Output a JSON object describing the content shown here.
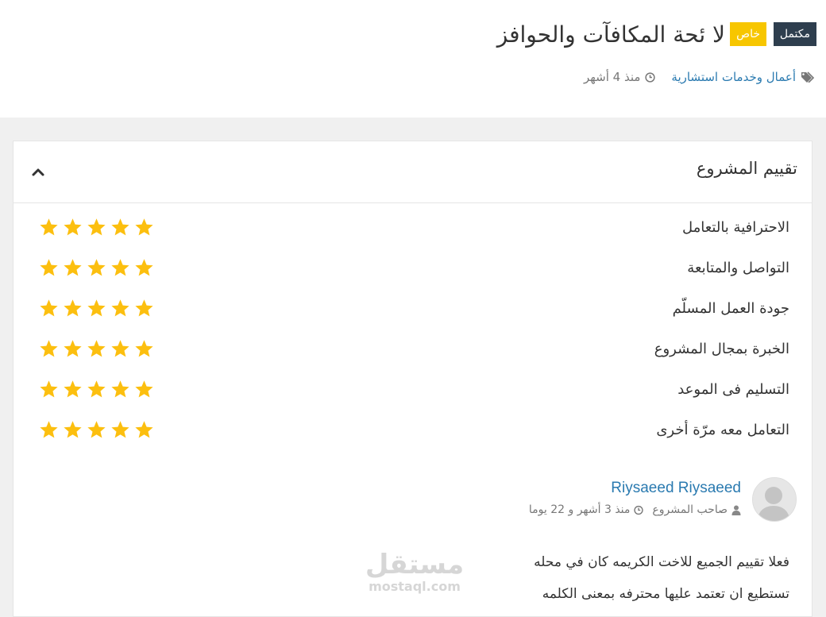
{
  "project": {
    "status_badge": "مكتمل",
    "privacy_badge": "خاص",
    "title": "لا ئحة المكافآت والحوافز",
    "category": "أعمال وخدمات استشارية",
    "posted": "منذ 4 أشهر"
  },
  "colors": {
    "accent_blue": "#2a7ab0",
    "badge_dark": "#2e3e4e",
    "badge_yellow": "#f7c600",
    "star": "#fcbf0f"
  },
  "rating": {
    "title": "تقييم المشروع",
    "criteria": [
      {
        "label": "الاحترافية بالتعامل",
        "stars": 5
      },
      {
        "label": "التواصل والمتابعة",
        "stars": 5
      },
      {
        "label": "جودة العمل المسلّم",
        "stars": 5
      },
      {
        "label": "الخبرة بمجال المشروع",
        "stars": 5
      },
      {
        "label": "التسليم فى الموعد",
        "stars": 5
      },
      {
        "label": "التعامل معه مرّة أخرى",
        "stars": 5
      }
    ]
  },
  "review": {
    "author": "Riysaeed Riysaeed",
    "role": "صاحب المشروع",
    "time": "منذ 3 أشهر و 22 يوما",
    "text_line1": "فعلا تقييم الجميع للاخت الكريمه كان في محله",
    "text_line2": "تستطيع ان تعتمد عليها محترفه بمعنى الكلمه"
  },
  "watermark": {
    "arabic": "مستقل",
    "latin": "mostaql.com"
  }
}
